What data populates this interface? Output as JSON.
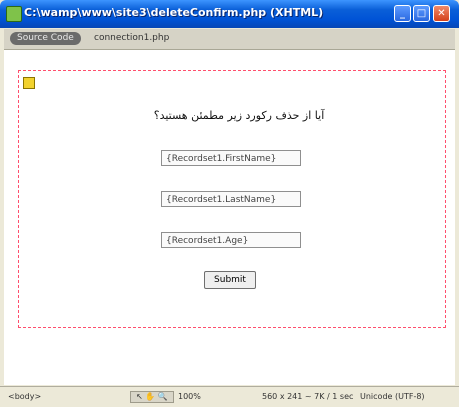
{
  "window": {
    "title": "C:\\wamp\\www\\site3\\deleteConfirm.php (XHTML)"
  },
  "tabs": {
    "source": "Source Code",
    "file": "connection1.php"
  },
  "form": {
    "question": "آیا از حذف رکورد زیر مطمئن هستید؟",
    "fields": [
      "{Recordset1.FirstName}",
      "{Recordset1.LastName}",
      "{Recordset1.Age}"
    ],
    "submit_label": "Submit"
  },
  "status": {
    "tag": "<body>",
    "zoom": "100%",
    "dimensions": "560 x 241 ~ 7K / 1 sec",
    "encoding": "Unicode (UTF-8)"
  },
  "colors": {
    "titlebar": "#0053d6",
    "form_border": "#ff4f6d"
  }
}
